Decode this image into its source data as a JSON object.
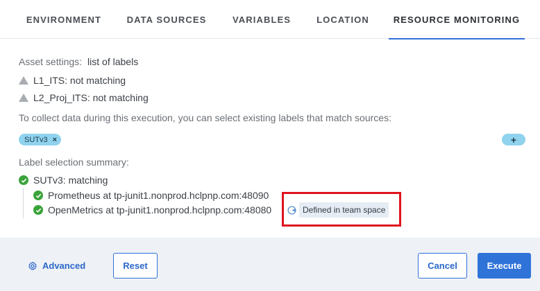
{
  "tabs": [
    {
      "label": "ENVIRONMENT",
      "active": false
    },
    {
      "label": "DATA SOURCES",
      "active": false
    },
    {
      "label": "VARIABLES",
      "active": false
    },
    {
      "label": "LOCATION",
      "active": false
    },
    {
      "label": "RESOURCE MONITORING",
      "active": true
    }
  ],
  "asset_settings": {
    "label": "Asset settings:",
    "value": "list of labels",
    "items": [
      {
        "icon": "warning-icon",
        "text": "L1_ITS: not matching"
      },
      {
        "icon": "warning-icon",
        "text": "L2_Proj_ITS: not matching"
      }
    ]
  },
  "instruction": "To collect data during this execution, you can select existing labels that match sources:",
  "selected_labels": [
    {
      "label": "SUTv3",
      "remove_glyph": "×"
    }
  ],
  "add_button": {
    "glyph": "+"
  },
  "summary": {
    "title": "Label selection summary:",
    "root": {
      "icon": "check-circle-icon",
      "text": "SUTv3: matching"
    },
    "children": [
      {
        "icon": "check-circle-icon",
        "text": "Prometheus at tp-junit1.nonprod.hclpnp.com:48090"
      },
      {
        "icon": "check-circle-icon",
        "text": "OpenMetrics at tp-junit1.nonprod.hclpnp.com:48080"
      }
    ],
    "badge": {
      "icon": "team-space-icon",
      "text": "Defined in team space"
    }
  },
  "footer": {
    "advanced": {
      "icon": "gear-icon",
      "label": "Advanced"
    },
    "reset": "Reset",
    "cancel": "Cancel",
    "execute": "Execute"
  },
  "colors": {
    "accent": "#2f73d9",
    "chip": "#8fd3ee",
    "success": "#3aa33a",
    "highlight": "#e0141e",
    "footer_bg": "#eef1f6"
  }
}
